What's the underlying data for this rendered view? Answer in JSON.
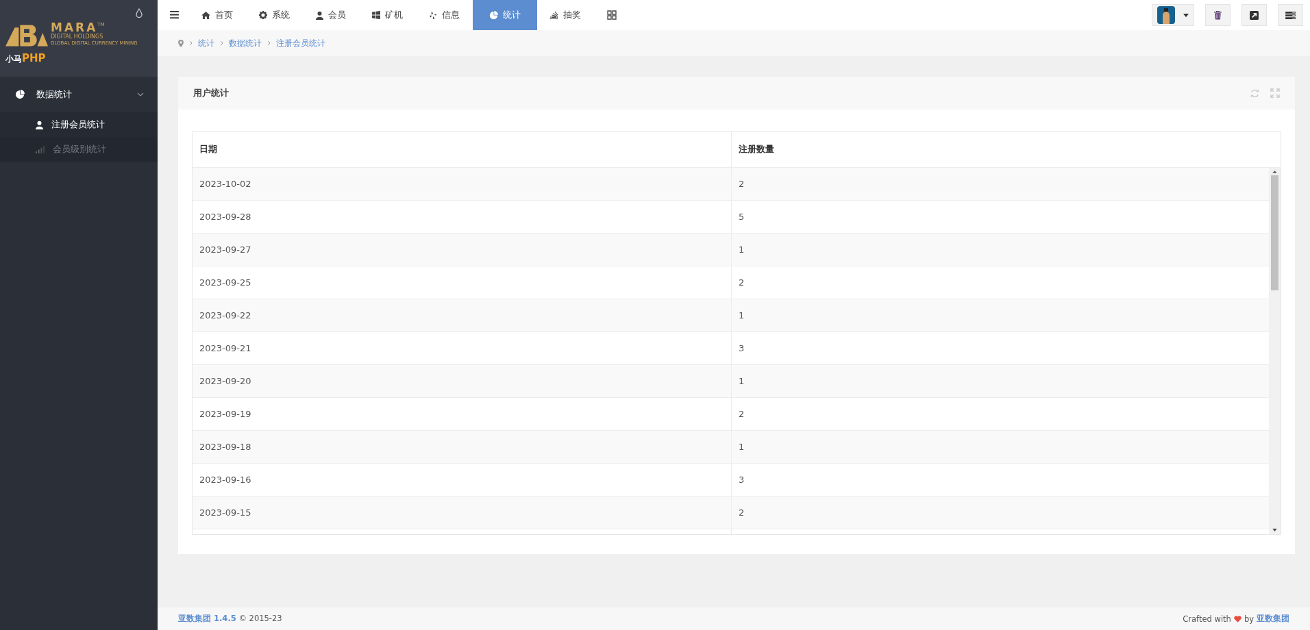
{
  "sidebar": {
    "logo": {
      "brand": "MARA",
      "tm": "TM",
      "subtitle": "DIGITAL HOLDINGS",
      "tagline": "GLOBAL DIGITAL CURRENCY MINING"
    },
    "site": {
      "name": "小马",
      "suffix": "PHP"
    },
    "menu": [
      {
        "label": "数据统计",
        "expanded": true,
        "children": [
          {
            "label": "注册会员统计",
            "selected": true
          },
          {
            "label": "会员级别统计",
            "selected": false
          }
        ]
      }
    ]
  },
  "topnav": {
    "tabs": [
      {
        "label": "首页",
        "selected": false
      },
      {
        "label": "系统",
        "selected": false
      },
      {
        "label": "会员",
        "selected": false
      },
      {
        "label": "矿机",
        "selected": false
      },
      {
        "label": "信息",
        "selected": false
      },
      {
        "label": "统计",
        "selected": true
      },
      {
        "label": "抽奖",
        "selected": false
      }
    ]
  },
  "breadcrumb": [
    "统计",
    "数据统计",
    "注册会员统计"
  ],
  "panel": {
    "title": "用户统计",
    "table": {
      "columns": [
        "日期",
        "注册数量"
      ],
      "rows": [
        [
          "2023-10-02",
          "2"
        ],
        [
          "2023-09-28",
          "5"
        ],
        [
          "2023-09-27",
          "1"
        ],
        [
          "2023-09-25",
          "2"
        ],
        [
          "2023-09-22",
          "1"
        ],
        [
          "2023-09-21",
          "3"
        ],
        [
          "2023-09-20",
          "1"
        ],
        [
          "2023-09-19",
          "2"
        ],
        [
          "2023-09-18",
          "1"
        ],
        [
          "2023-09-16",
          "3"
        ],
        [
          "2023-09-15",
          "2"
        ]
      ]
    }
  },
  "footer": {
    "brand": "亚数集团 1.4.5",
    "copyright": "© 2015-23",
    "crafted": "Crafted with",
    "by": "by",
    "link": "亚数集团"
  }
}
